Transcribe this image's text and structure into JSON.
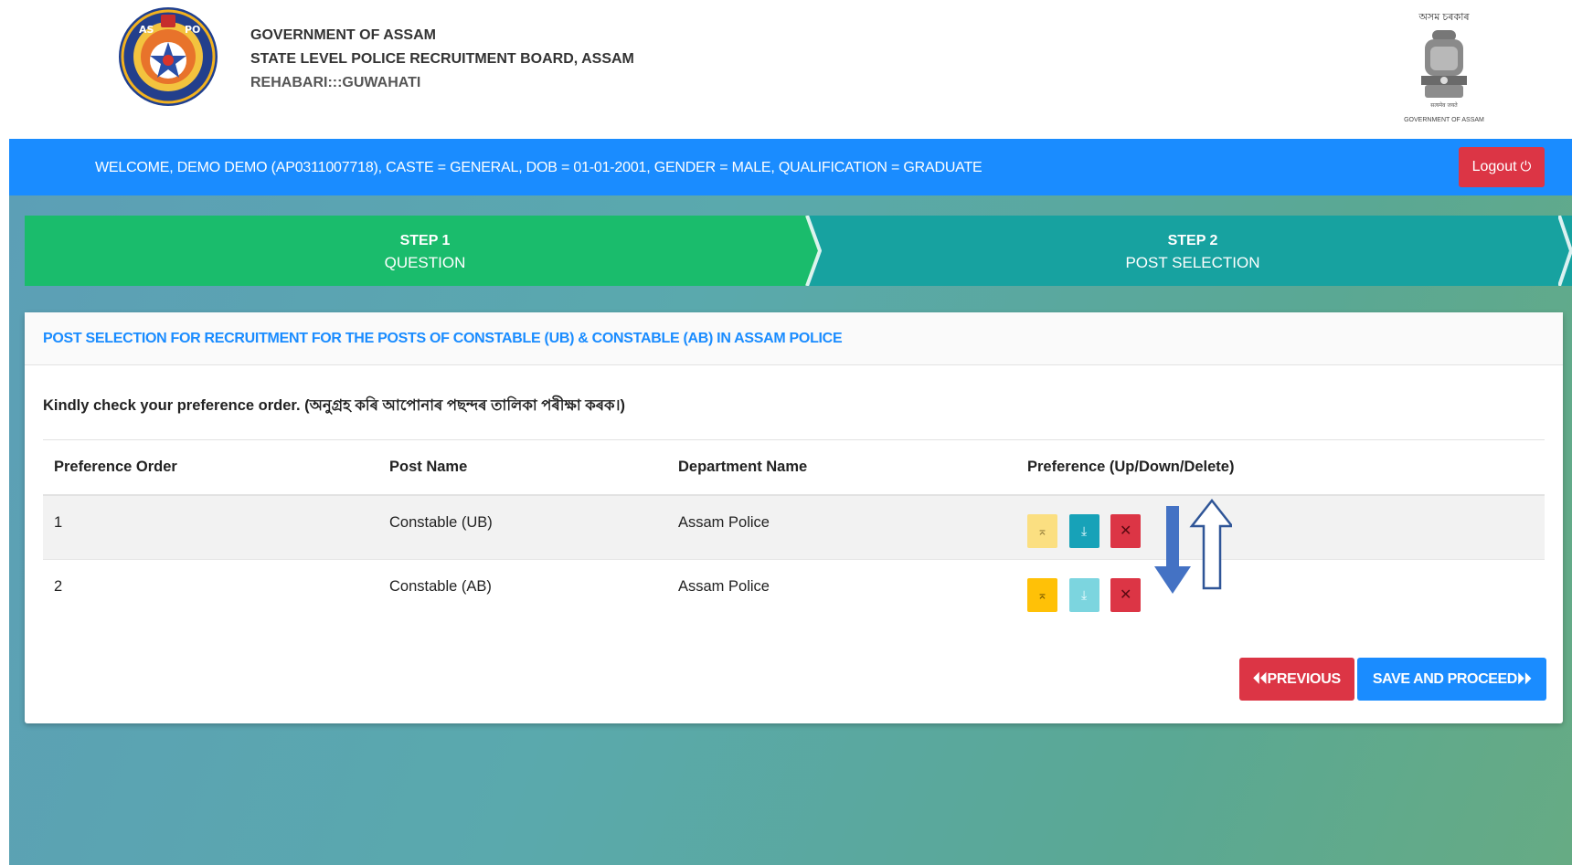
{
  "header": {
    "line1": "GOVERNMENT OF ASSAM",
    "line2": "STATE LEVEL POLICE RECRUITMENT BOARD, ASSAM",
    "line3": "REHABARI:::GUWAHATI",
    "emblem_top_text": "অসম চৰকাৰ",
    "emblem_bottom_text": "GOVERNMENT OF ASSAM",
    "logo_left": "assam-police-logo",
    "logo_right": "national-emblem"
  },
  "welcome_bar": {
    "text": "WELCOME, DEMO DEMO (AP0311007718), CASTE = GENERAL, DOB = 01-01-2001, GENDER = MALE, QUALIFICATION = GRADUATE",
    "logout_label": "Logout",
    "logout_icon": "power-icon",
    "color": "#1a8cff"
  },
  "steps": [
    {
      "number": "STEP 1",
      "name": "QUESTION",
      "color": "#1abc6c"
    },
    {
      "number": "STEP 2",
      "name": "POST SELECTION",
      "color": "#17a2a0"
    }
  ],
  "panel": {
    "title": "POST SELECTION FOR RECRUITMENT FOR THE POSTS OF CONSTABLE (UB) & CONSTABLE (AB) IN ASSAM POLICE",
    "instruction": "Kindly check your preference order. (অনুগ্ৰহ কৰি আপোনাৰ পছন্দৰ তালিকা পৰীক্ষা কৰক।)",
    "table": {
      "headers": [
        "Preference Order",
        "Post Name",
        "Department Name",
        "Preference (Up/Down/Delete)"
      ],
      "rows": [
        {
          "order": "1",
          "post": "Constable (UB)",
          "department": "Assam Police"
        },
        {
          "order": "2",
          "post": "Constable (AB)",
          "department": "Assam Police"
        }
      ]
    },
    "buttons": {
      "previous": "⏴⏴PREVIOUS",
      "save": "SAVE AND PROCEED⏵⏵"
    }
  },
  "icons": {
    "move_up": "arrow-up-to-top-icon",
    "move_down": "arrow-down-to-bottom-icon",
    "delete": "close-icon",
    "annotation_arrows": "up-down-arrows-icon"
  },
  "colors": {
    "primary": "#1a8cff",
    "danger": "#dc3545",
    "warning": "#ffc107",
    "info": "#17a2b8"
  }
}
